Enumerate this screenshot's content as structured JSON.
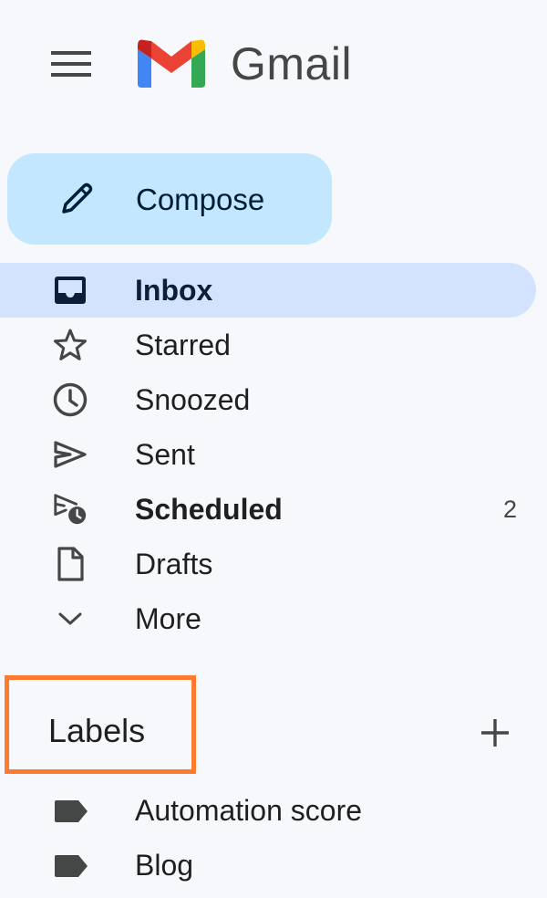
{
  "header": {
    "brand": "Gmail",
    "menu_icon": "hamburger-menu-icon",
    "logo_icon": "gmail-logo-icon"
  },
  "compose": {
    "label": "Compose",
    "icon": "pencil-icon",
    "background": "#c2e7ff"
  },
  "nav": {
    "items": [
      {
        "label": "Inbox",
        "icon": "inbox-icon",
        "active": true,
        "bold": true
      },
      {
        "label": "Starred",
        "icon": "star-icon"
      },
      {
        "label": "Snoozed",
        "icon": "clock-icon"
      },
      {
        "label": "Sent",
        "icon": "send-icon"
      },
      {
        "label": "Scheduled",
        "icon": "scheduled-send-icon",
        "bold": true,
        "count": "2"
      },
      {
        "label": "Drafts",
        "icon": "draft-icon"
      },
      {
        "label": "More",
        "icon": "chevron-down-icon"
      }
    ]
  },
  "labels": {
    "title": "Labels",
    "add_icon": "plus-icon",
    "highlight_color": "#ff7a2f",
    "items": [
      {
        "label": "Automation score",
        "icon": "label-tag-icon"
      },
      {
        "label": "Blog",
        "icon": "label-tag-icon"
      }
    ]
  },
  "colors": {
    "background": "#f6f8fc",
    "active_nav": "#d3e3fd"
  }
}
